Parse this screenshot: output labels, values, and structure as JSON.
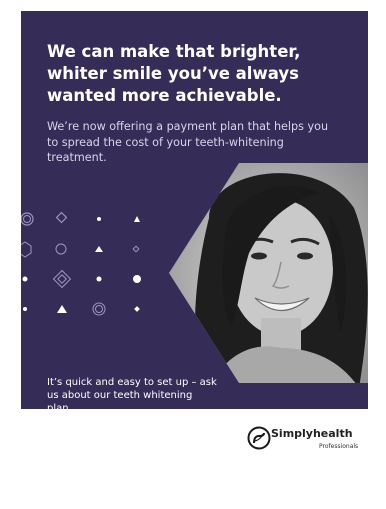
{
  "headline": "We can make that brighter, whiter smile you’ve always wanted more achievable.",
  "subhead": "We’re now offering a payment plan that helps you to spread the cost of your teeth-whitening treatment.",
  "cta": "It’s quick and easy to set up – ask us about our teeth whitening plan.",
  "logo": {
    "name": "Simplyhealth",
    "tagline": "Professionals"
  },
  "colors": {
    "panel": "#352d57",
    "accent": "#ffffff"
  },
  "legal": {
    "line1": "",
    "line2": "",
    "line3": ""
  }
}
